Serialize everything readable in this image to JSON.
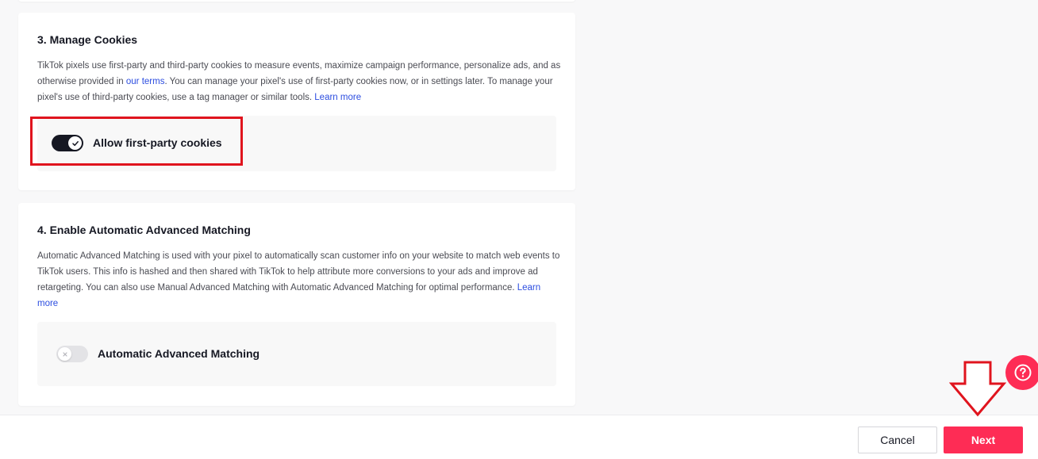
{
  "colors": {
    "accent": "#fe2c55",
    "annotation": "#e0141e",
    "link": "#2c4de0",
    "toggle_on": "#161823",
    "toggle_off": "#e3e3e6"
  },
  "manage_cookies": {
    "title": "3. Manage Cookies",
    "desc_part1": "TikTok pixels use first-party and third-party cookies to measure events, maximize campaign performance, personalize ads, and as otherwise provided in ",
    "terms_link": "our terms",
    "desc_part2": ". You can manage your pixel's use of first-party cookies now, or in settings later. To manage your pixel's use of third-party cookies, use a tag manager or similar tools. ",
    "learn_more": "Learn more",
    "toggle_label": "Allow first-party cookies",
    "toggle_state": "on"
  },
  "advanced_matching": {
    "title": "4. Enable Automatic Advanced Matching",
    "desc": "Automatic Advanced Matching is used with your pixel to automatically scan customer info on your website to match web events to TikTok users. This info is hashed and then shared with TikTok to help attribute more conversions to your ads and improve ad retargeting. You can also use Manual Advanced Matching with Automatic Advanced Matching for optimal performance. ",
    "learn_more": "Learn more",
    "toggle_label": "Automatic Advanced Matching",
    "toggle_state": "off"
  },
  "footer": {
    "cancel_label": "Cancel",
    "next_label": "Next"
  },
  "icons": {
    "help": "question-circle-icon",
    "check": "check-icon",
    "cross": "x-icon",
    "arrow": "down-arrow-annotation"
  }
}
